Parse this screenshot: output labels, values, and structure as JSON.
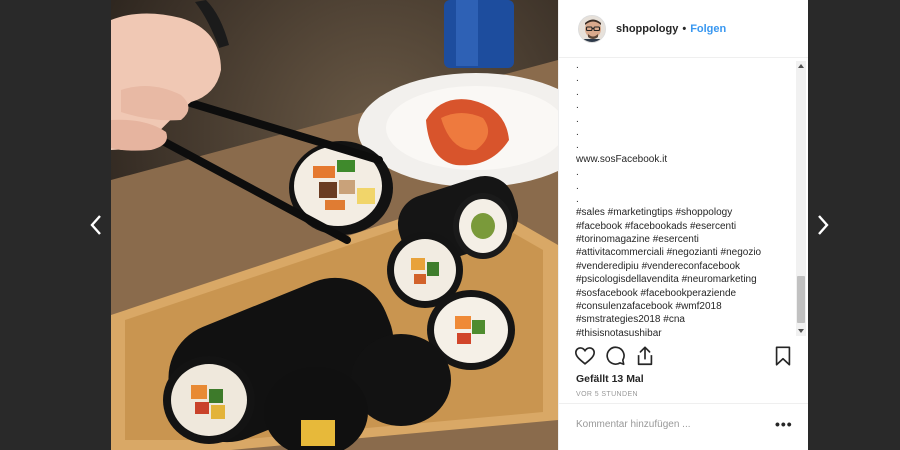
{
  "header": {
    "username": "shoppology",
    "separator": "•",
    "follow_label": "Folgen"
  },
  "caption_lines": [
    ".",
    ".",
    ".",
    ".",
    ".",
    ".",
    ".",
    "www.sosFacebook.it",
    ".",
    ".",
    ".",
    "#sales #marketingtips #shoppology",
    "#facebook #facebookads #esercenti",
    "#torinomagazine #esercenti",
    "#attivitacommerciali #negozianti #negozio",
    "#venderedipiu #vendereconfacebook",
    "#psicologisdellavendita #neuromarketing",
    "#sosfacebook #facebookperaziende",
    "#consulenzafacebook #wmf2018",
    "#smstrategies2018 #cna",
    "#thisisnotasushibar"
  ],
  "actions": {
    "like_icon": "heart-icon",
    "comment_icon": "comment-icon",
    "share_icon": "share-icon",
    "save_icon": "bookmark-icon"
  },
  "likes": "Gefällt 13 Mal",
  "timestamp": "VOR 5 STUNDEN",
  "comment": {
    "placeholder": "Kommentar hinzufügen ...",
    "more_label": "•••"
  },
  "colors": {
    "link_blue": "#3897f0",
    "text": "#262626",
    "muted": "#999999"
  }
}
